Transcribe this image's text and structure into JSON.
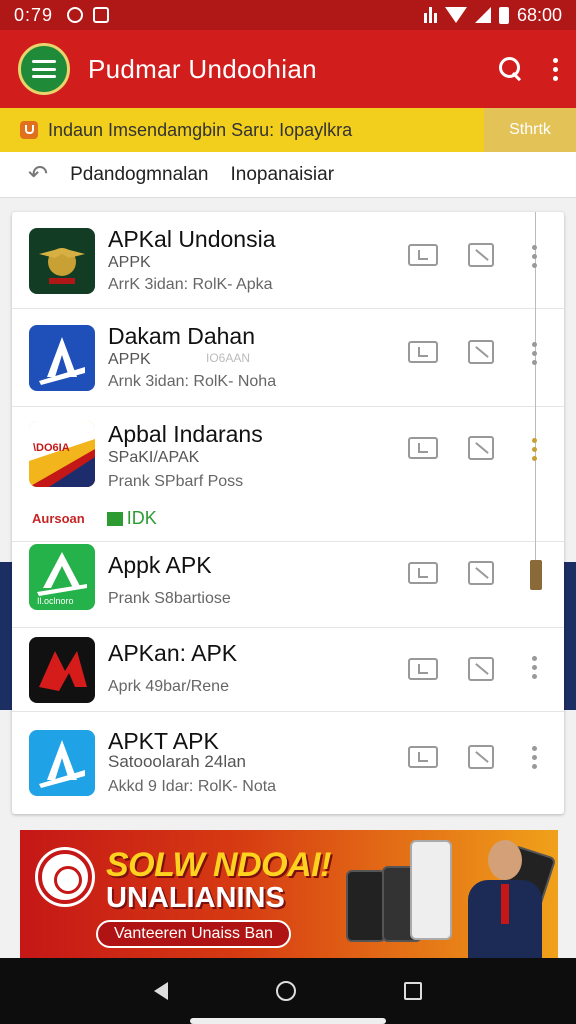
{
  "status_bar": {
    "time": "0:79",
    "clock_right": "68:00"
  },
  "app_bar": {
    "title": "Pudmar Undoohian"
  },
  "notice": {
    "text": "Indaun Imsendamgbin Saru: Iopaylkra",
    "button": "Sthrtk"
  },
  "nav": {
    "crumb1": "Pdandogmnalan",
    "crumb2": "Inopanaisiar"
  },
  "apps": [
    {
      "name": "APKal Undonsia",
      "line2": "APPK",
      "line3": "ArrK 3idan: RolK- Apka"
    },
    {
      "name": "Dakam Dahan",
      "line2": "APPK",
      "line2b": "IO6AAN",
      "line3": "Arnk 3idan: RolK- Noha"
    },
    {
      "name": "Apbal Indarans",
      "line2": "SPaKI/APAK",
      "line3": "Prank SPbarf Poss",
      "tag1": "Aursoan",
      "tag2": "IDK"
    },
    {
      "name": "Appk APK",
      "line3": "Prank S8bartiose",
      "icon_text": "Il.oclnoro"
    },
    {
      "name": "APKan: APK",
      "line3": "Aprk 49bar/Rene"
    },
    {
      "name": "APKT APK",
      "line2": "Satooolarah 24lan",
      "line3": "Akkd 9 Idar: RolK- Nota"
    }
  ],
  "app3_icon_text": "\\DO6IA",
  "promo": {
    "headline": "SOLW NDOAI!",
    "subheadline": "UNALIANINS",
    "cta": "Vanteeren Unaiss Ban"
  },
  "colors": {
    "primary": "#d21d1d",
    "status": "#b01717",
    "notice": "#f2cf1c",
    "band": "#1c2f63"
  }
}
